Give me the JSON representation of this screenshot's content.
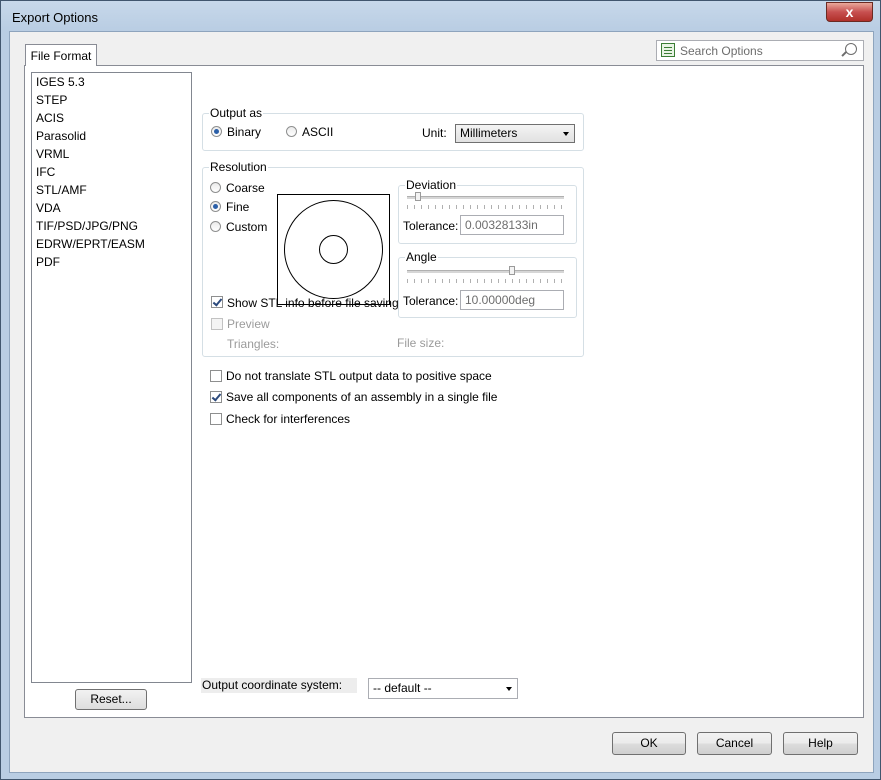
{
  "window": {
    "title": "Export Options",
    "close_glyph": "x"
  },
  "tab": {
    "label": "File Format"
  },
  "search": {
    "placeholder": "Search Options"
  },
  "formats": [
    "IGES 5.3",
    "STEP",
    "ACIS",
    "Parasolid",
    "VRML",
    "IFC",
    "STL/AMF",
    "VDA",
    "TIF/PSD/JPG/PNG",
    "EDRW/EPRT/EASM",
    "PDF"
  ],
  "selected_format": "STL/AMF",
  "reset_label": "Reset...",
  "output_as": {
    "legend": "Output as",
    "binary_label": "Binary",
    "ascii_label": "ASCII",
    "selected": "Binary",
    "unit_label": "Unit:",
    "unit_value": "Millimeters"
  },
  "resolution": {
    "legend": "Resolution",
    "coarse_label": "Coarse",
    "fine_label": "Fine",
    "custom_label": "Custom",
    "selected": "Fine",
    "show_stl_info_label": "Show STL info before file saving",
    "show_stl_info_checked": true,
    "preview_label": "Preview",
    "preview_checked": false,
    "triangles_label": "Triangles:",
    "file_size_label": "File size:",
    "deviation": {
      "legend": "Deviation",
      "tolerance_label": "Tolerance:",
      "tolerance_value": "0.00328133in"
    },
    "angle": {
      "legend": "Angle",
      "tolerance_label": "Tolerance:",
      "tolerance_value": "10.00000deg"
    }
  },
  "options": {
    "no_translate_label": "Do not translate STL output data to positive space",
    "no_translate_checked": false,
    "save_all_label": "Save all components of an assembly in a single file",
    "save_all_checked": true,
    "interference_label": "Check for interferences",
    "interference_checked": false
  },
  "coordinate": {
    "label": "Output coordinate system:",
    "value": "-- default --"
  },
  "buttons": {
    "ok": "OK",
    "cancel": "Cancel",
    "help": "Help"
  }
}
